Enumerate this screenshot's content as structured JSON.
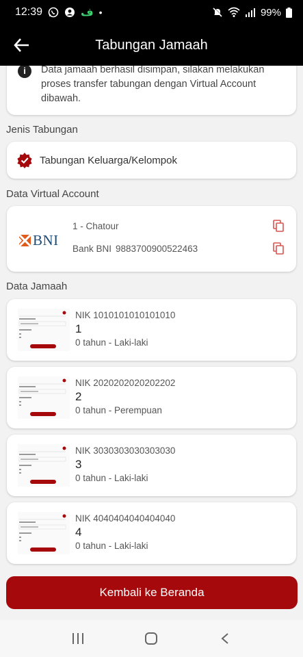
{
  "status_bar": {
    "time": "12:39",
    "battery": "99%",
    "app_badge": "ف"
  },
  "header": {
    "title": "Tabungan Jamaah"
  },
  "info": {
    "text": "Data jamaah berhasil disimpan, silakan melakukan proses transfer tabungan dengan Virtual Account dibawah."
  },
  "savings_type": {
    "label": "Jenis Tabungan",
    "value": "Tabungan Keluarga/Kelompok"
  },
  "virtual_account": {
    "label": "Data Virtual Account",
    "bank_logo": "BNI",
    "name_line": "1 - Chatour",
    "bank_name": "Bank BNI",
    "account_number": "9883700900522463"
  },
  "members": {
    "label": "Data Jamaah",
    "items": [
      {
        "nik": "NIK 1010101010101010",
        "name": "1",
        "detail": "0 tahun - Laki-laki"
      },
      {
        "nik": "NIK 2020202020202202",
        "name": "2",
        "detail": "0 tahun - Perempuan"
      },
      {
        "nik": "NIK 3030303030303030",
        "name": "3",
        "detail": "0 tahun - Laki-laki"
      },
      {
        "nik": "NIK 4040404040404040",
        "name": "4",
        "detail": "0 tahun - Laki-laki"
      }
    ]
  },
  "cta": {
    "label": "Kembali ke Beranda"
  },
  "colors": {
    "accent": "#a5090c",
    "bni_blue": "#1a4b7a",
    "bni_orange": "#e05a1b",
    "header_bg": "#000000"
  },
  "icons": {
    "back": "arrow-left-icon",
    "info": "info-icon",
    "badge": "verified-badge-icon",
    "copy": "copy-icon",
    "nav": [
      "recent-apps-icon",
      "home-icon",
      "back-nav-icon"
    ]
  }
}
